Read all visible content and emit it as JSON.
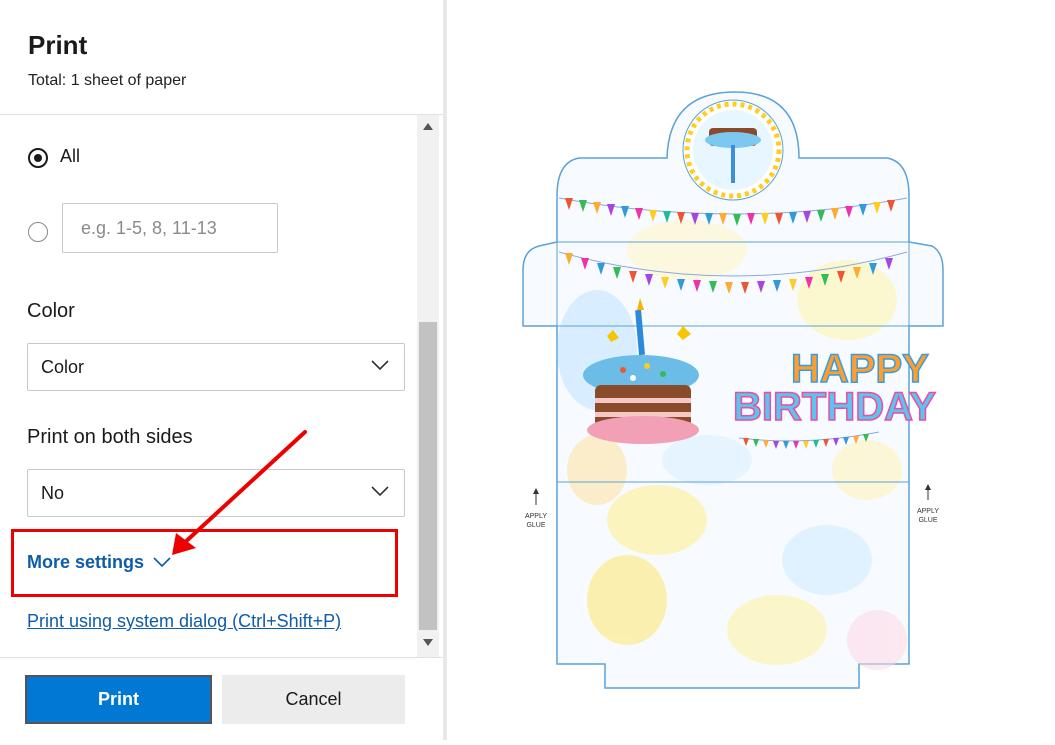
{
  "header": {
    "title": "Print",
    "subtitle": "Total: 1 sheet of paper"
  },
  "pages": {
    "option_all": "All",
    "custom_placeholder": "e.g. 1-5, 8, 11-13"
  },
  "color": {
    "label": "Color",
    "value": "Color"
  },
  "duplex": {
    "label": "Print on both sides",
    "value": "No"
  },
  "more_settings": "More settings",
  "system_dialog_link": "Print using system dialog (Ctrl+Shift+P)",
  "buttons": {
    "print": "Print",
    "cancel": "Cancel"
  },
  "preview": {
    "headline_1": "HAPPY",
    "headline_2": "BIRTHDAY",
    "glue_text": "APPLY GLUE",
    "glue_left_1": "APPLY",
    "glue_left_2": "GLUE",
    "glue_right_1": "APPLY",
    "glue_right_2": "GLUE"
  },
  "colors": {
    "accent": "#0078d4",
    "link": "#0f5ca8",
    "highlight": "#e00000"
  }
}
